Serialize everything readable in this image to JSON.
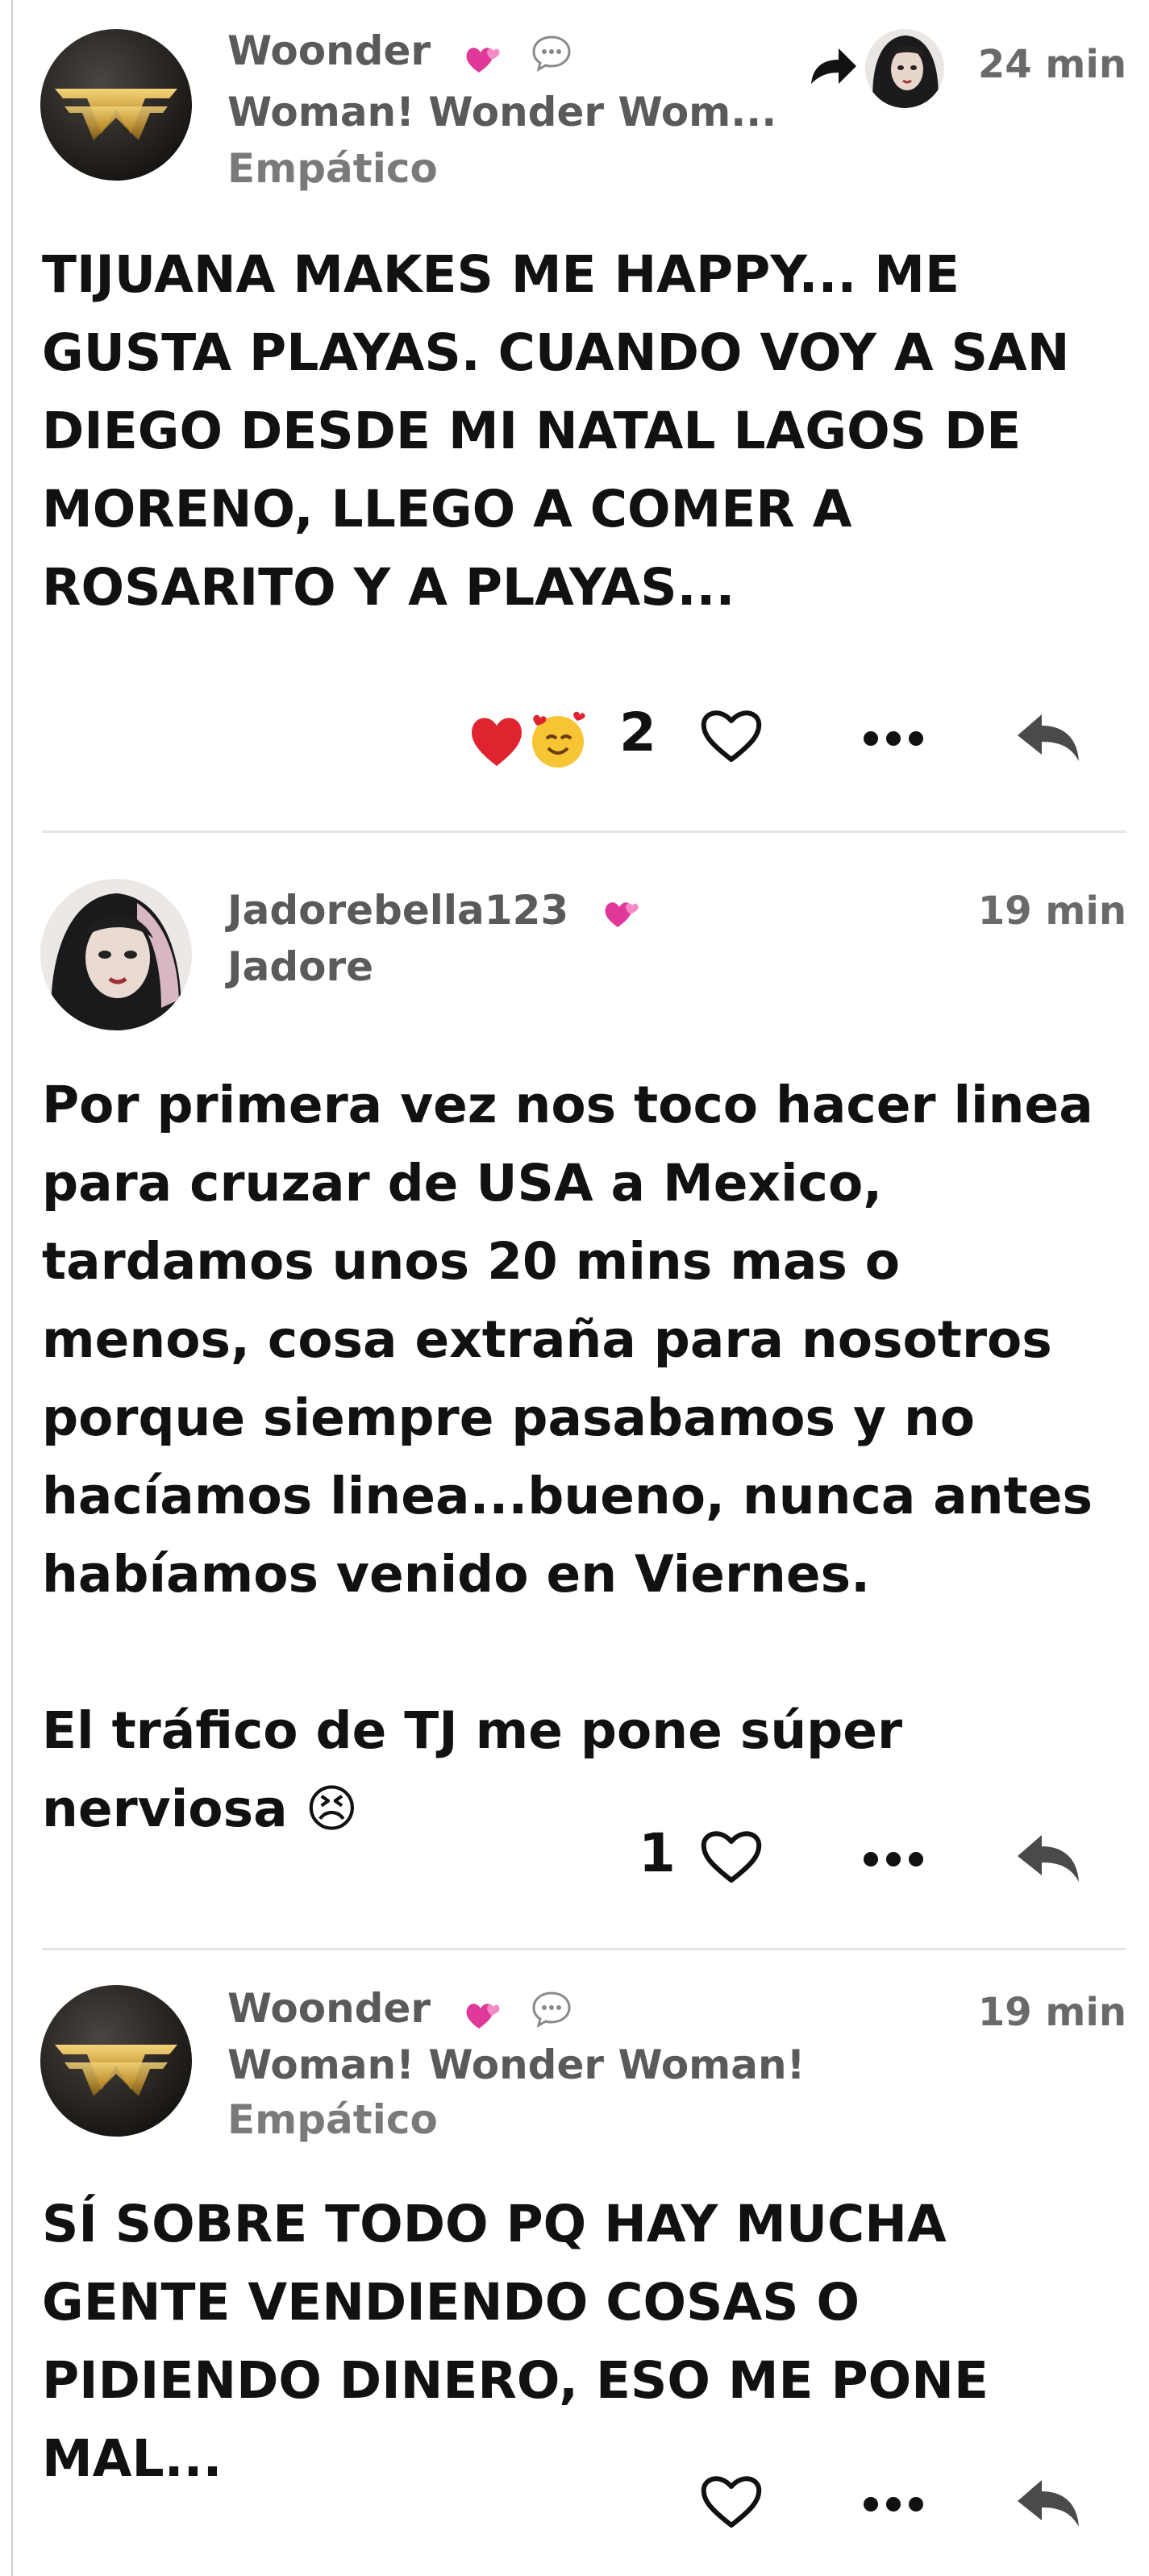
{
  "posts": [
    {
      "username": "Woonder",
      "display_name": "Woman! Wonder Wom...",
      "mood": "Empático",
      "time": "24 min",
      "text": "TIJUANA MAKES ME HAPPY... ME GUSTA PLAYAS. CUANDO VOY A SAN DIEGO DESDE MI NATAL LAGOS DE MORENO, LLEGO A COMER A ROSARITO Y A PLAYAS...",
      "likes": "2",
      "avatar_icon": "wonder-woman-logo-icon",
      "has_reply_to": true
    },
    {
      "username": "Jadorebella123",
      "display_name": "Jadore",
      "time": "19 min",
      "text": "Por primera vez nos toco hacer linea para cruzar de USA a Mexico, tardamos unos 20 mins mas o menos, cosa extraña para nosotros porque siempre pasabamos y no hacíamos linea...bueno, nunca antes habíamos venido en Viernes.\n\nEl tráfico de TJ me pone súper nerviosa 😣",
      "likes": "1",
      "avatar_icon": "gothic-woman-avatar"
    },
    {
      "username": "Woonder",
      "display_name": "Woman! Wonder Woman!",
      "mood": "Empático",
      "time": "19 min",
      "text": "SÍ SOBRE TODO PQ HAY MUCHA GENTE VENDIENDO COSAS O PIDIENDO DINERO, ESO ME PONE MAL...",
      "avatar_icon": "wonder-woman-logo-icon"
    }
  ],
  "colors": {
    "accent_pink": "#e0399a",
    "text_dark": "#111111",
    "text_meta": "#5a5a5a",
    "heart_red": "#e0242f"
  }
}
